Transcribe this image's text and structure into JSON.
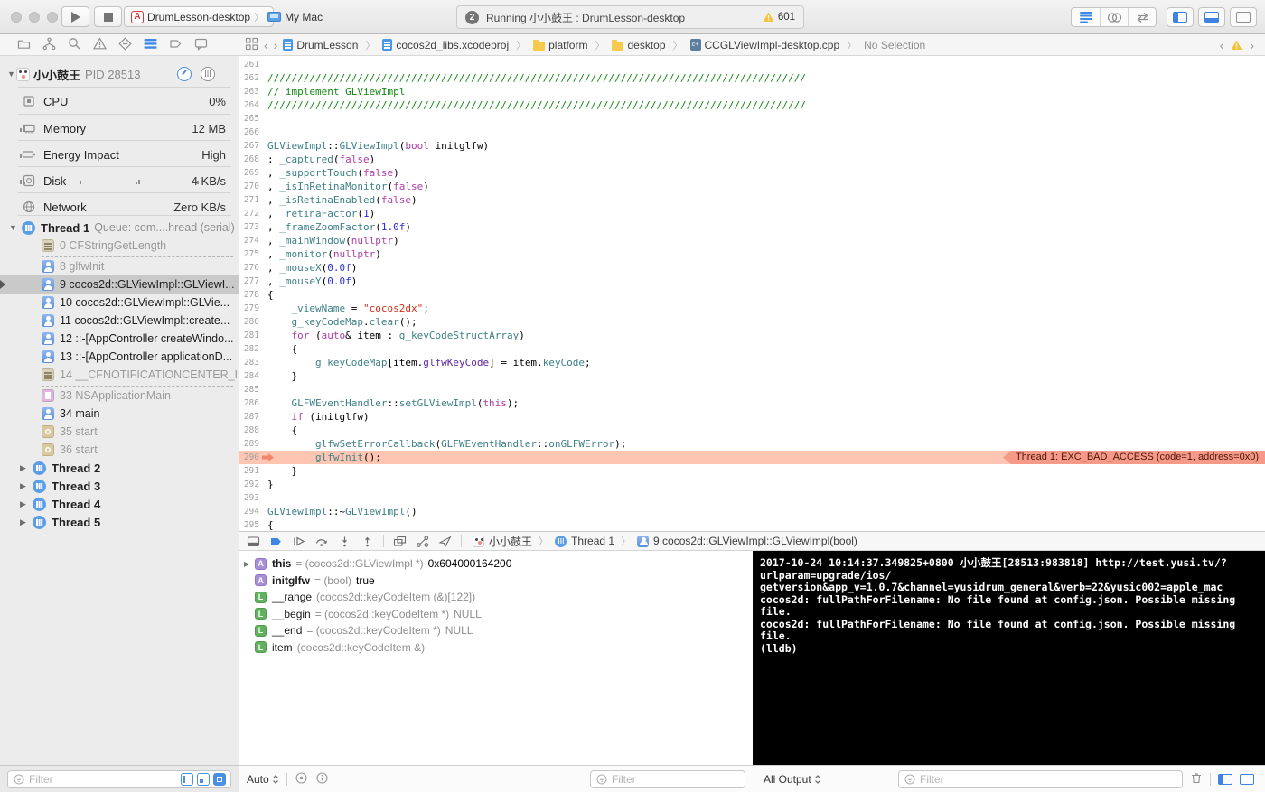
{
  "toolbar": {
    "scheme": {
      "name": "DrumLesson-desktop",
      "target": "My Mac"
    },
    "activity": {
      "badge": "2",
      "text": "Running 小小鼓王 : DrumLesson-desktop",
      "warning_count": "601"
    }
  },
  "jumpbar": {
    "crumbs": [
      {
        "label": "DrumLesson"
      },
      {
        "label": "cocos2d_libs.xcodeproj"
      },
      {
        "label": "platform"
      },
      {
        "label": "desktop"
      },
      {
        "label": "CCGLViewImpl-desktop.cpp"
      },
      {
        "label": "No Selection"
      }
    ]
  },
  "sidebar": {
    "process": {
      "name": "小小鼓王",
      "pid": "PID 28513"
    },
    "gauges": [
      {
        "label": "CPU",
        "value": "0%"
      },
      {
        "label": "Memory",
        "value": "12 MB"
      },
      {
        "label": "Energy Impact",
        "value": "High"
      },
      {
        "label": "Disk",
        "value": "4 KB/s"
      },
      {
        "label": "Network",
        "value": "Zero KB/s"
      }
    ],
    "thread1": {
      "label": "Thread 1",
      "queue": "Queue: com....hread (serial)"
    },
    "frames": [
      {
        "icon": "lines",
        "label": "0 CFStringGetLength",
        "dim": true
      },
      "sep",
      {
        "icon": "person",
        "label": "8 glfwInit",
        "dim": true
      },
      {
        "icon": "person",
        "label": "9 cocos2d::GLViewImpl::GLViewI...",
        "sel": true
      },
      {
        "icon": "person",
        "label": "10 cocos2d::GLViewImpl::GLVie..."
      },
      {
        "icon": "person",
        "label": "11 cocos2d::GLViewImpl::create..."
      },
      {
        "icon": "person",
        "label": "12 ::-[AppController createWindo..."
      },
      {
        "icon": "person",
        "label": "13 ::-[AppController applicationD..."
      },
      {
        "icon": "lines",
        "label": "14 __CFNOTIFICATIONCENTER_I...",
        "dim": true
      },
      "sep",
      {
        "icon": "doc",
        "label": "33 NSApplicationMain",
        "dim": true
      },
      {
        "icon": "person",
        "label": "34 main"
      },
      {
        "icon": "gear",
        "label": "35 start",
        "dim": true
      },
      {
        "icon": "gear",
        "label": "36 start",
        "dim": true
      }
    ],
    "threads": [
      "Thread 2",
      "Thread 3",
      "Thread 4",
      "Thread 5"
    ],
    "filter_placeholder": "Filter"
  },
  "editor": {
    "crash": {
      "line": 290,
      "label": "Thread 1: EXC_BAD_ACCESS (code=1, address=0x0)"
    },
    "lines": [
      {
        "n": 261,
        "t": []
      },
      {
        "n": 262,
        "t": [
          [
            "c",
            "//////////////////////////////////////////////////////////////////////////////////////////"
          ]
        ]
      },
      {
        "n": 263,
        "t": [
          [
            "c",
            "// implement GLViewImpl"
          ]
        ]
      },
      {
        "n": 264,
        "t": [
          [
            "c",
            "//////////////////////////////////////////////////////////////////////////////////////////"
          ]
        ]
      },
      {
        "n": 265,
        "t": []
      },
      {
        "n": 266,
        "t": []
      },
      {
        "n": 267,
        "t": [
          [
            "t",
            "GLViewImpl"
          ],
          [
            "p",
            "::"
          ],
          [
            "t",
            "GLViewImpl"
          ],
          [
            "p",
            "("
          ],
          [
            "k",
            "bool"
          ],
          [
            "p",
            " initglfw)"
          ]
        ]
      },
      {
        "n": 268,
        "t": [
          [
            "p",
            ": "
          ],
          [
            "t",
            "_captured"
          ],
          [
            "p",
            "("
          ],
          [
            "k",
            "false"
          ],
          [
            "p",
            ")"
          ]
        ]
      },
      {
        "n": 269,
        "t": [
          [
            "p",
            ", "
          ],
          [
            "t",
            "_supportTouch"
          ],
          [
            "p",
            "("
          ],
          [
            "k",
            "false"
          ],
          [
            "p",
            ")"
          ]
        ]
      },
      {
        "n": 270,
        "t": [
          [
            "p",
            ", "
          ],
          [
            "t",
            "_isInRetinaMonitor"
          ],
          [
            "p",
            "("
          ],
          [
            "k",
            "false"
          ],
          [
            "p",
            ")"
          ]
        ]
      },
      {
        "n": 271,
        "t": [
          [
            "p",
            ", "
          ],
          [
            "t",
            "_isRetinaEnabled"
          ],
          [
            "p",
            "("
          ],
          [
            "k",
            "false"
          ],
          [
            "p",
            ")"
          ]
        ]
      },
      {
        "n": 272,
        "t": [
          [
            "p",
            ", "
          ],
          [
            "t",
            "_retinaFactor"
          ],
          [
            "p",
            "("
          ],
          [
            "n",
            "1"
          ],
          [
            "p",
            ")"
          ]
        ]
      },
      {
        "n": 273,
        "t": [
          [
            "p",
            ", "
          ],
          [
            "t",
            "_frameZoomFactor"
          ],
          [
            "p",
            "("
          ],
          [
            "n",
            "1.0f"
          ],
          [
            "p",
            ")"
          ]
        ]
      },
      {
        "n": 274,
        "t": [
          [
            "p",
            ", "
          ],
          [
            "t",
            "_mainWindow"
          ],
          [
            "p",
            "("
          ],
          [
            "k",
            "nullptr"
          ],
          [
            "p",
            ")"
          ]
        ]
      },
      {
        "n": 275,
        "t": [
          [
            "p",
            ", "
          ],
          [
            "t",
            "_monitor"
          ],
          [
            "p",
            "("
          ],
          [
            "k",
            "nullptr"
          ],
          [
            "p",
            ")"
          ]
        ]
      },
      {
        "n": 276,
        "t": [
          [
            "p",
            ", "
          ],
          [
            "t",
            "_mouseX"
          ],
          [
            "p",
            "("
          ],
          [
            "n",
            "0.0f"
          ],
          [
            "p",
            ")"
          ]
        ]
      },
      {
        "n": 277,
        "t": [
          [
            "p",
            ", "
          ],
          [
            "t",
            "_mouseY"
          ],
          [
            "p",
            "("
          ],
          [
            "n",
            "0.0f"
          ],
          [
            "p",
            ")"
          ]
        ]
      },
      {
        "n": 278,
        "t": [
          [
            "p",
            "{"
          ]
        ]
      },
      {
        "n": 279,
        "t": [
          [
            "p",
            "    "
          ],
          [
            "t",
            "_viewName"
          ],
          [
            "p",
            " = "
          ],
          [
            "s",
            "\"cocos2dx\""
          ],
          [
            "p",
            ";"
          ]
        ]
      },
      {
        "n": 280,
        "t": [
          [
            "p",
            "    "
          ],
          [
            "t",
            "g_keyCodeMap"
          ],
          [
            "p",
            "."
          ],
          [
            "t",
            "clear"
          ],
          [
            "p",
            "();"
          ]
        ]
      },
      {
        "n": 281,
        "t": [
          [
            "p",
            "    "
          ],
          [
            "k",
            "for"
          ],
          [
            "p",
            " ("
          ],
          [
            "k",
            "auto"
          ],
          [
            "p",
            "& item : "
          ],
          [
            "t",
            "g_keyCodeStructArray"
          ],
          [
            "p",
            ")"
          ]
        ]
      },
      {
        "n": 282,
        "t": [
          [
            "p",
            "    {"
          ]
        ]
      },
      {
        "n": 283,
        "t": [
          [
            "p",
            "        "
          ],
          [
            "t",
            "g_keyCodeMap"
          ],
          [
            "p",
            "[item."
          ],
          [
            "f",
            "glfwKeyCode"
          ],
          [
            "p",
            "] = item."
          ],
          [
            "t",
            "keyCode"
          ],
          [
            "p",
            ";"
          ]
        ]
      },
      {
        "n": 284,
        "t": [
          [
            "p",
            "    }"
          ]
        ]
      },
      {
        "n": 285,
        "t": []
      },
      {
        "n": 286,
        "t": [
          [
            "p",
            "    "
          ],
          [
            "t",
            "GLFWEventHandler"
          ],
          [
            "p",
            "::"
          ],
          [
            "t",
            "setGLViewImpl"
          ],
          [
            "p",
            "("
          ],
          [
            "k",
            "this"
          ],
          [
            "p",
            ");"
          ]
        ]
      },
      {
        "n": 287,
        "t": [
          [
            "p",
            "    "
          ],
          [
            "k",
            "if"
          ],
          [
            "p",
            " (initglfw)"
          ]
        ]
      },
      {
        "n": 288,
        "t": [
          [
            "p",
            "    {"
          ]
        ]
      },
      {
        "n": 289,
        "t": [
          [
            "p",
            "        "
          ],
          [
            "t",
            "glfwSetErrorCallback"
          ],
          [
            "p",
            "("
          ],
          [
            "t",
            "GLFWEventHandler"
          ],
          [
            "p",
            "::"
          ],
          [
            "t",
            "onGLFWError"
          ],
          [
            "p",
            ");"
          ]
        ]
      },
      {
        "n": 290,
        "t": [
          [
            "p",
            "        "
          ],
          [
            "t",
            "glfwInit"
          ],
          [
            "p",
            "();"
          ]
        ]
      },
      {
        "n": 291,
        "t": [
          [
            "p",
            "    }"
          ]
        ]
      },
      {
        "n": 292,
        "t": [
          [
            "p",
            "}"
          ]
        ]
      },
      {
        "n": 293,
        "t": []
      },
      {
        "n": 294,
        "t": [
          [
            "t",
            "GLViewImpl"
          ],
          [
            "p",
            "::~"
          ],
          [
            "t",
            "GLViewImpl"
          ],
          [
            "p",
            "()"
          ]
        ]
      },
      {
        "n": 295,
        "t": [
          [
            "p",
            "{"
          ]
        ]
      }
    ]
  },
  "debugbar": {
    "crumbs": [
      {
        "icon": "app",
        "label": "小小鼓王"
      },
      {
        "icon": "thread",
        "label": "Thread 1"
      },
      {
        "icon": "person",
        "label": "9 cocos2d::GLViewImpl::GLViewImpl(bool)"
      }
    ]
  },
  "variables": {
    "scope": "Auto",
    "filter_placeholder": "Filter",
    "rows": [
      {
        "k": "A",
        "dis": true,
        "bold": true,
        "name": "this",
        "mid": "= (cocos2d::GLViewImpl *)",
        "val": "0x604000164200"
      },
      {
        "k": "A",
        "bold": true,
        "name": "initglfw",
        "mid": "= (bool)",
        "val": "true"
      },
      {
        "k": "L",
        "name": "__range",
        "mid": "(cocos2d::keyCodeItem (&)[122])",
        "val": ""
      },
      {
        "k": "L",
        "name": "__begin",
        "mid": "= (cocos2d::keyCodeItem *)",
        "val": "NULL",
        "gray": true
      },
      {
        "k": "L",
        "name": "__end",
        "mid": "= (cocos2d::keyCodeItem *)",
        "val": "NULL",
        "gray": true
      },
      {
        "k": "L",
        "name": "item",
        "mid": "(cocos2d::keyCodeItem &)",
        "val": ""
      }
    ]
  },
  "console": {
    "scope": "All Output",
    "filter_placeholder": "Filter",
    "lines": [
      "2017-10-24 10:14:37.349825+0800 小小鼓王[28513:983818] http://test.yusi.tv/?",
      "urlparam=upgrade/ios/",
      "getversion&app_v=1.0.7&channel=yusidrum_general&verb=22&yusic002=apple_mac",
      "cocos2d: fullPathForFilename: No file found at config.json. Possible missing",
      "file.",
      "cocos2d: fullPathForFilename: No file found at config.json. Possible missing",
      "file.",
      "(lldb)"
    ]
  }
}
